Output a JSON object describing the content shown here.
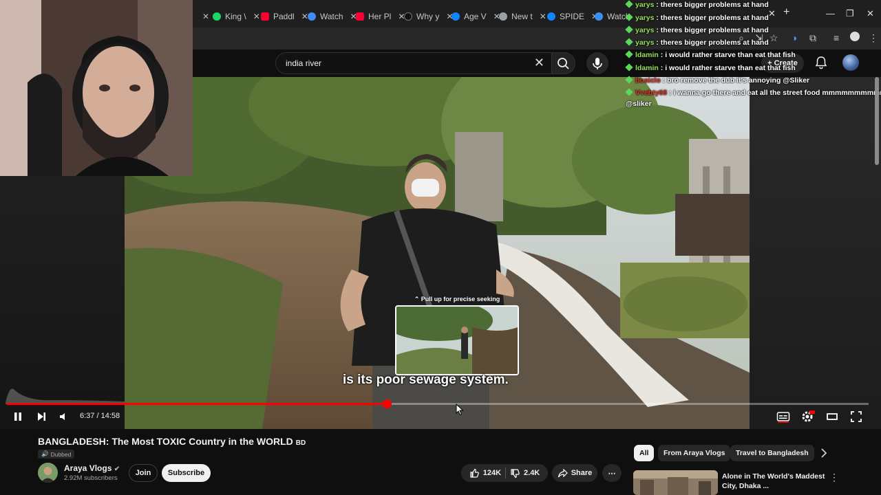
{
  "browser": {
    "tabs": [
      {
        "label": "King \\",
        "color": "#1ed760"
      },
      {
        "label": "Paddl",
        "color": "#ff0033"
      },
      {
        "label": "Watch",
        "color": "#3d8ff5"
      },
      {
        "label": "Her Pl",
        "color": "#ff0033"
      },
      {
        "label": "Why y",
        "color": "#111111"
      },
      {
        "label": "Age V",
        "color": "#1185fe"
      },
      {
        "label": "New t",
        "color": "#9aa0a6"
      },
      {
        "label": "SPIDE",
        "color": "#1185fe"
      },
      {
        "label": "Watch",
        "color": "#3d8ff5"
      }
    ],
    "new_tab": "+"
  },
  "youtube": {
    "search": {
      "value": "india river"
    },
    "create_label": "Create"
  },
  "chat": [
    {
      "user": "yarys",
      "sep": " : ",
      "text": "theres bigger problems at hand",
      "color": "green"
    },
    {
      "user": "yarys",
      "sep": " : ",
      "text": "theres bigger problems at hand",
      "color": "green"
    },
    {
      "user": "yarys",
      "sep": " : ",
      "text": "theres bigger problems at hand",
      "color": "green"
    },
    {
      "user": "yarys",
      "sep": " : ",
      "text": "theres bigger problems at hand",
      "color": "green"
    },
    {
      "user": "ldamin",
      "sep": " : ",
      "text": "i would rather starve than eat that fish",
      "color": "green"
    },
    {
      "user": "ldamin",
      "sep": " : ",
      "text": "i would rather starve than eat that fish",
      "color": "green"
    },
    {
      "user": "bosiclo",
      "sep": " : ",
      "text": "bro remove the dub it's annoying @Sliker",
      "color": "red"
    },
    {
      "user": "Vvebty68",
      "sep": " : ",
      "text": "i wanna go there and eat all the street food mmmmmmmmmmmm",
      "color": "red"
    }
  ],
  "chat_wrap": "@sliker",
  "player": {
    "subtitle": "is its poor sewage system.",
    "seek_hint": "⌃ Pull up for precise seeking",
    "time": "6:37 / 14:58",
    "progress": 0.4408
  },
  "video": {
    "title": "BANGLADESH: The Most TOXIC Country in the WORLD",
    "flag": "BD",
    "dubbed": "Dubbed",
    "channel": "Araya Vlogs",
    "subscribers": "2.92M subscribers",
    "join": "Join",
    "subscribe": "Subscribe",
    "likes": "124K",
    "dislikes": "2.4K",
    "share": "Share"
  },
  "chips": [
    "All",
    "From Araya Vlogs",
    "Travel to Bangladesh"
  ],
  "recommended": {
    "title": "Alone in The World's Maddest City, Dhaka ..."
  }
}
